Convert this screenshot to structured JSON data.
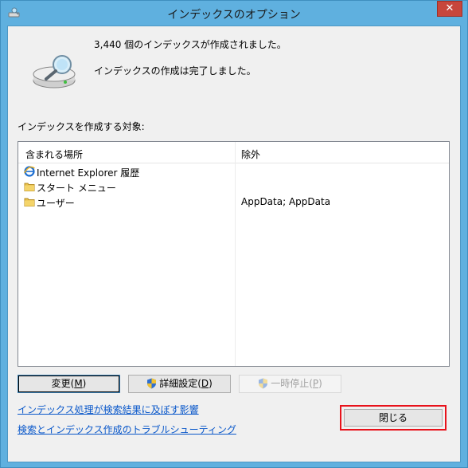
{
  "window": {
    "title": "インデックスのオプション",
    "close_glyph": "✕"
  },
  "status": {
    "count_line": "3,440 個のインデックスが作成されました。",
    "state_line": "インデックスの作成は完了しました。"
  },
  "section_label": "インデックスを作成する対象:",
  "list": {
    "columns": [
      "含まれる場所",
      "除外"
    ],
    "rows": [
      {
        "icon": "ie-icon",
        "location": "Internet Explorer 履歴",
        "exclude": ""
      },
      {
        "icon": "folder-icon",
        "location": "スタート メニュー",
        "exclude": ""
      },
      {
        "icon": "folder-icon",
        "location": "ユーザー",
        "exclude": "AppData; AppData"
      }
    ]
  },
  "buttons": {
    "modify_label": "変更(",
    "modify_key": "M",
    "modify_close": ")",
    "advanced_label": "詳細設定(",
    "advanced_key": "D",
    "advanced_close": ")",
    "pause_label": "一時停止(",
    "pause_key": "P",
    "pause_close": ")",
    "close_label": "閉じる"
  },
  "links": {
    "impact": "インデックス処理が検索結果に及ぼす影響",
    "troubleshoot": "検索とインデックス作成のトラブルシューティング"
  },
  "colors": {
    "window_frame": "#5fb0df",
    "close_button": "#c7463c",
    "highlight_border": "#e8121b",
    "link": "#0a58ca"
  }
}
